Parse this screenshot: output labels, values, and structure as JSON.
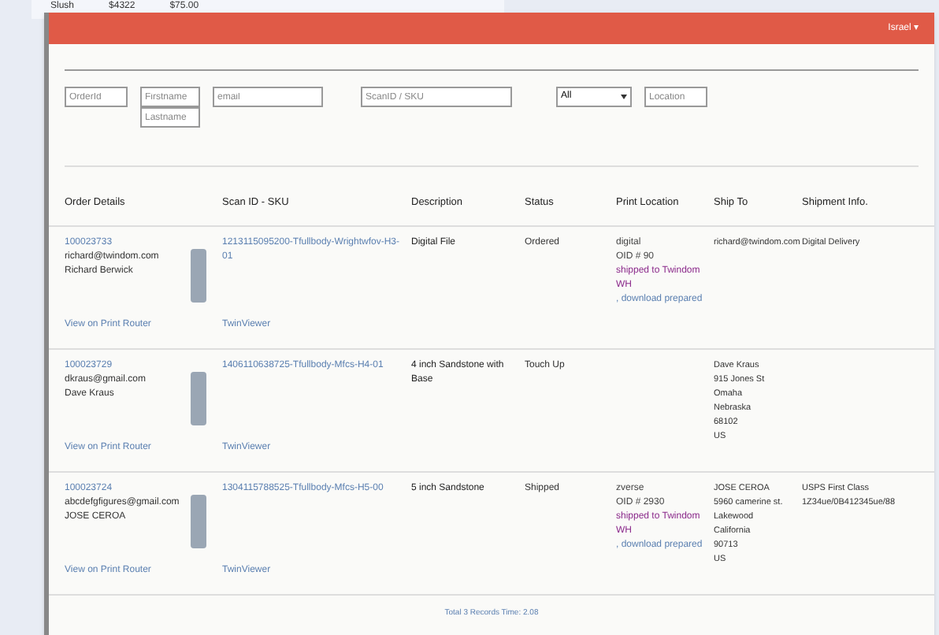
{
  "background_window": {
    "cells": [
      "Slush",
      "$4322",
      "$75.00"
    ]
  },
  "header": {
    "user_menu": "Israel ▾"
  },
  "filters": {
    "order_id": {
      "placeholder": "OrderId"
    },
    "first_name": {
      "placeholder": "Firstname"
    },
    "last_name": {
      "placeholder": "Lastname"
    },
    "email": {
      "placeholder": "email"
    },
    "scan_id": {
      "placeholder": "ScanID / SKU"
    },
    "status": {
      "value": "All"
    },
    "location": {
      "placeholder": "Location"
    }
  },
  "table": {
    "columns": [
      "Order Details",
      "Scan ID - SKU",
      "Description",
      "Status",
      "Print Location",
      "Ship To",
      "Shipment Info."
    ],
    "rows": [
      {
        "order_id": "100023733",
        "email": "richard@twindom.com",
        "name": "Richard Berwick",
        "print_link": "View on Print Router",
        "scan": "1213115095200-Tfullbody-Wrightwfov-H3-01",
        "viewer": "TwinViewer",
        "description": "Digital File",
        "status": "Ordered",
        "print_location": [
          {
            "kind": "plain",
            "text": "digital"
          },
          {
            "kind": "plain",
            "text": "OID # 90"
          },
          {
            "kind": "shipped",
            "text": "shipped to Twindom WH"
          },
          {
            "kind": "download",
            "text": ", download prepared"
          }
        ],
        "ship_to": [
          "richard@twindom.com"
        ],
        "shipment": [
          "Digital Delivery"
        ]
      },
      {
        "order_id": "100023729",
        "email": "dkraus@gmail.com",
        "name": "Dave Kraus",
        "print_link": "View on Print Router",
        "scan": "1406110638725-Tfullbody-Mfcs-H4-01",
        "viewer": "TwinViewer",
        "description": "4 inch Sandstone with Base",
        "status": "Touch Up",
        "print_location": [],
        "ship_to": [
          "Dave Kraus",
          "915 Jones St",
          "Omaha",
          "Nebraska",
          "68102",
          "US"
        ],
        "shipment": []
      },
      {
        "order_id": "100023724",
        "email": "abcdefgfigures@gmail.com",
        "name": "JOSE CEROA",
        "print_link": "View on Print Router",
        "scan": "1304115788525-Tfullbody-Mfcs-H5-00",
        "viewer": "TwinViewer",
        "description": "5 inch Sandstone",
        "status": "Shipped",
        "print_location": [
          {
            "kind": "plain",
            "text": "zverse"
          },
          {
            "kind": "plain",
            "text": "OID # 2930"
          },
          {
            "kind": "shipped",
            "text": "shipped to Twindom WH"
          },
          {
            "kind": "download",
            "text": ", download prepared"
          }
        ],
        "ship_to": [
          "JOSE CEROA",
          "5960 camerine st.",
          "Lakewood",
          "California",
          "90713",
          "US"
        ],
        "shipment": [
          "USPS First Class",
          "1Z34ue/0B412345ue/88"
        ]
      }
    ]
  },
  "footer": "Total 3 Records Time: 2.08"
}
